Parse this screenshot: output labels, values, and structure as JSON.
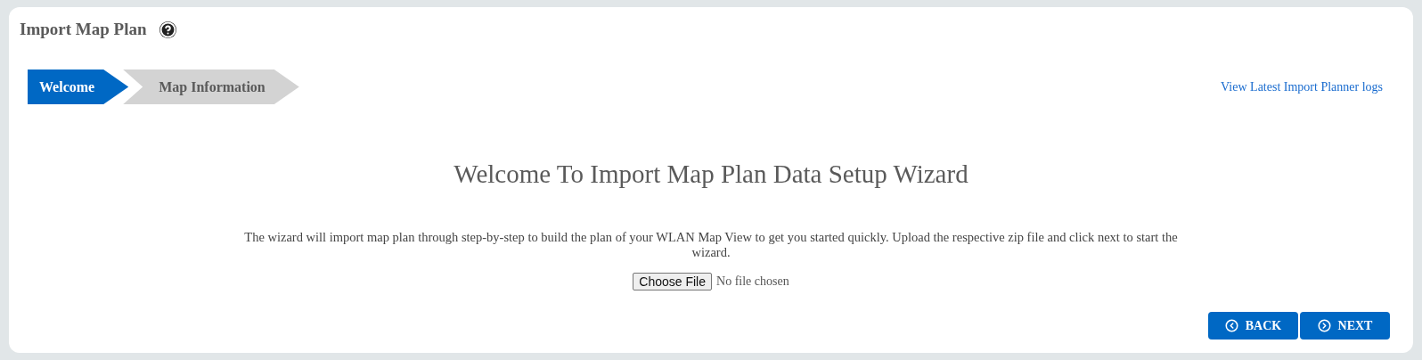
{
  "title": "Import Map Plan",
  "steps": [
    {
      "label": "Welcome",
      "selected": true
    },
    {
      "label": "Map Information",
      "selected": false
    }
  ],
  "logs_link": "View Latest Import Planner logs",
  "heading": "Welcome To Import Map Plan Data Setup Wizard",
  "description": "The wizard will import map plan through step-by-step to build the plan of your WLAN Map View to get you started quickly. Upload the respective zip file and click next to start the wizard.",
  "file_input": {
    "button": "Choose File",
    "status": "No file chosen"
  },
  "buttons": [
    {
      "kind": "back",
      "label": "BACK"
    },
    {
      "kind": "next",
      "label": "NEXT"
    }
  ]
}
